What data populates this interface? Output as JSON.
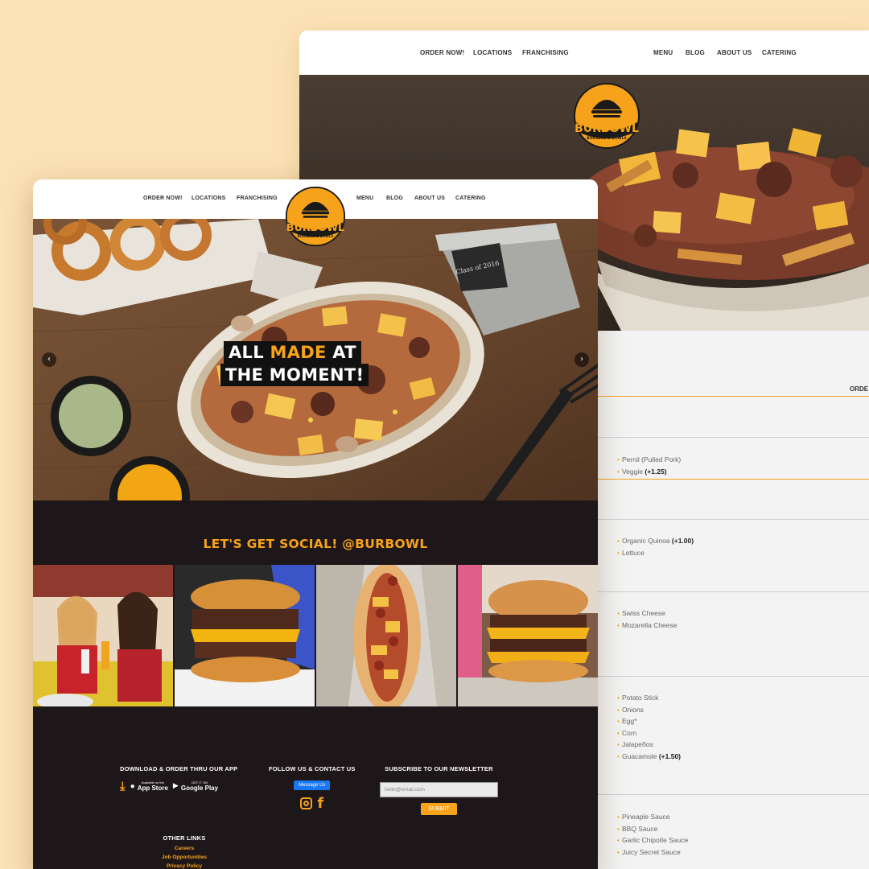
{
  "brand": {
    "name": "BURBOWL",
    "tagline": "BURGERS & BOWLS",
    "accent": "#f7a21b",
    "dark_bg": "#1e1719"
  },
  "nav": {
    "left": [
      "ORDER NOW!",
      "LOCATIONS",
      "FRANCHISING"
    ],
    "right": [
      "MENU",
      "BLOG",
      "ABOUT US",
      "CATERING"
    ]
  },
  "back_page": {
    "order_label": "ORDE",
    "groups": [
      {
        "items": [
          {
            "name": "Pernil (Pulled Pork)",
            "extra": ""
          },
          {
            "name": "Veggie",
            "extra": "(+1.25)"
          }
        ]
      },
      {
        "items": [
          {
            "name": "Organic Quinoa",
            "extra": "(+1.00)"
          },
          {
            "name": "Lettuce",
            "extra": ""
          }
        ]
      },
      {
        "items": [
          {
            "name": "Swiss Cheese",
            "extra": ""
          },
          {
            "name": "Mozarella Cheese",
            "extra": ""
          }
        ]
      },
      {
        "items": [
          {
            "name": "Potato Stick",
            "extra": ""
          },
          {
            "name": "Onions",
            "extra": ""
          },
          {
            "name": "Egg*",
            "extra": ""
          },
          {
            "name": "Corn",
            "extra": ""
          },
          {
            "name": "Jalapeños",
            "extra": ""
          },
          {
            "name": "Guacamole",
            "extra": "(+1.50)"
          }
        ]
      },
      {
        "items": [
          {
            "name": "Pineaple Sauce",
            "extra": ""
          },
          {
            "name": "BBQ Sauce",
            "extra": ""
          },
          {
            "name": "Garlic Chipotle Sauce",
            "extra": ""
          },
          {
            "name": "Juicy Secret Sauce",
            "extra": ""
          }
        ]
      }
    ]
  },
  "hero": {
    "line1_a": "ALL ",
    "line1_b": "MADE",
    "line1_c": " AT",
    "line2": "THE MOMENT!",
    "bucket_text": "Class of 2016",
    "prev_arrow": "‹",
    "next_arrow": "›"
  },
  "social": {
    "title": "LET'S GET SOCIAL! @BURBOWL"
  },
  "footer": {
    "download_heading": "DOWNLOAD & ORDER THRU OUR APP",
    "app_store_small": "Available on the",
    "app_store": "App Store",
    "google_play_small": "GET IT ON",
    "google_play": "Google Play",
    "follow_heading": "FOLLOW US & CONTACT US",
    "message_button": "Message Us",
    "newsletter_heading": "SUBSCRIBE TO OUR NEWSLETTER",
    "email_placeholder": "hello@email.com",
    "submit": "SUBMIT",
    "other_links_heading": "OTHER LINKS",
    "links": [
      "Careers",
      "Job Opportunities",
      "Privacy Policy"
    ]
  }
}
